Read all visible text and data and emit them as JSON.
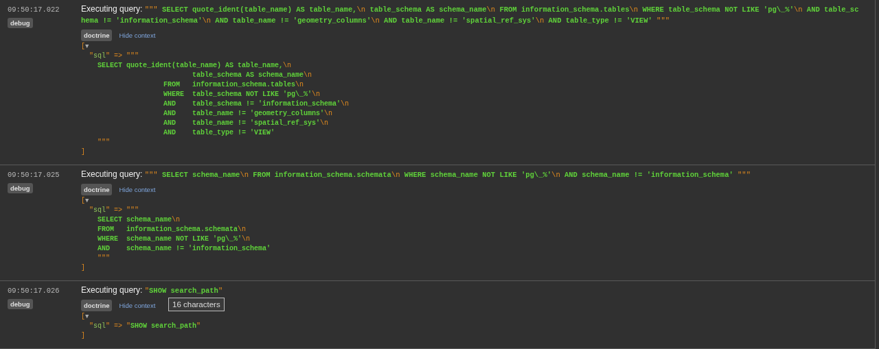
{
  "entries": [
    {
      "time": "09:50:17.022",
      "level": "debug",
      "label": "Executing query:",
      "query": [
        {
          "kind": "punct",
          "text": "\"\"\""
        },
        {
          "kind": "code",
          "text": " SELECT quote_ident(table_name) AS table_name,"
        },
        {
          "kind": "punct",
          "text": "\\n"
        },
        {
          "kind": "code",
          "text": " table_schema AS schema_name"
        },
        {
          "kind": "punct",
          "text": "\\n"
        },
        {
          "kind": "code",
          "text": " FROM information_schema.tables"
        },
        {
          "kind": "punct",
          "text": "\\n"
        },
        {
          "kind": "code",
          "text": " WHERE table_schema NOT LIKE 'pg\\_%'"
        },
        {
          "kind": "punct",
          "text": "\\n"
        },
        {
          "kind": "code",
          "text": " AND table_schema != 'information_schema'"
        },
        {
          "kind": "punct",
          "text": "\\n"
        },
        {
          "kind": "code",
          "text": " AND table_name != 'geometry_columns'"
        },
        {
          "kind": "punct",
          "text": "\\n"
        },
        {
          "kind": "code",
          "text": " AND table_name != 'spatial_ref_sys'"
        },
        {
          "kind": "punct",
          "text": "\\n"
        },
        {
          "kind": "code",
          "text": " AND table_type != 'VIEW' "
        },
        {
          "kind": "punct",
          "text": "\"\"\""
        }
      ],
      "channel": "doctrine",
      "context_link": "Hide context",
      "dump": {
        "open": "[",
        "toggle": "▼",
        "close": "]",
        "lines": [
          [
            {
              "kind": "punct",
              "text": "  \""
            },
            {
              "kind": "key",
              "text": "sql"
            },
            {
              "kind": "punct",
              "text": "\" => \"\"\""
            }
          ],
          [
            {
              "kind": "code",
              "text": "    SELECT quote_ident(table_name) AS table_name,"
            },
            {
              "kind": "punct",
              "text": "\\n"
            }
          ],
          [
            {
              "kind": "code",
              "text": "                           table_schema AS schema_name"
            },
            {
              "kind": "punct",
              "text": "\\n"
            }
          ],
          [
            {
              "kind": "code",
              "text": "                    FROM   information_schema.tables"
            },
            {
              "kind": "punct",
              "text": "\\n"
            }
          ],
          [
            {
              "kind": "code",
              "text": "                    WHERE  table_schema NOT LIKE 'pg\\_%'"
            },
            {
              "kind": "punct",
              "text": "\\n"
            }
          ],
          [
            {
              "kind": "code",
              "text": "                    AND    table_schema != 'information_schema'"
            },
            {
              "kind": "punct",
              "text": "\\n"
            }
          ],
          [
            {
              "kind": "code",
              "text": "                    AND    table_name != 'geometry_columns'"
            },
            {
              "kind": "punct",
              "text": "\\n"
            }
          ],
          [
            {
              "kind": "code",
              "text": "                    AND    table_name != 'spatial_ref_sys'"
            },
            {
              "kind": "punct",
              "text": "\\n"
            }
          ],
          [
            {
              "kind": "code",
              "text": "                    AND    table_type != 'VIEW'"
            }
          ],
          [
            {
              "kind": "punct",
              "text": "    \"\"\""
            }
          ]
        ]
      }
    },
    {
      "time": "09:50:17.025",
      "level": "debug",
      "label": "Executing query:",
      "query": [
        {
          "kind": "punct",
          "text": "\"\"\""
        },
        {
          "kind": "code",
          "text": " SELECT schema_name"
        },
        {
          "kind": "punct",
          "text": "\\n"
        },
        {
          "kind": "code",
          "text": " FROM information_schema.schemata"
        },
        {
          "kind": "punct",
          "text": "\\n"
        },
        {
          "kind": "code",
          "text": " WHERE schema_name NOT LIKE 'pg\\_%'"
        },
        {
          "kind": "punct",
          "text": "\\n"
        },
        {
          "kind": "code",
          "text": " AND schema_name != 'information_schema' "
        },
        {
          "kind": "punct",
          "text": "\"\"\""
        }
      ],
      "channel": "doctrine",
      "context_link": "Hide context",
      "dump": {
        "open": "[",
        "toggle": "▼",
        "close": "]",
        "lines": [
          [
            {
              "kind": "punct",
              "text": "  \""
            },
            {
              "kind": "key",
              "text": "sql"
            },
            {
              "kind": "punct",
              "text": "\" => \"\"\""
            }
          ],
          [
            {
              "kind": "code",
              "text": "    SELECT schema_name"
            },
            {
              "kind": "punct",
              "text": "\\n"
            }
          ],
          [
            {
              "kind": "code",
              "text": "    FROM   information_schema.schemata"
            },
            {
              "kind": "punct",
              "text": "\\n"
            }
          ],
          [
            {
              "kind": "code",
              "text": "    WHERE  schema_name NOT LIKE 'pg\\_%'"
            },
            {
              "kind": "punct",
              "text": "\\n"
            }
          ],
          [
            {
              "kind": "code",
              "text": "    AND    schema_name != 'information_schema'"
            }
          ],
          [
            {
              "kind": "punct",
              "text": "    \"\"\""
            }
          ]
        ]
      }
    },
    {
      "time": "09:50:17.026",
      "level": "debug",
      "label": "Executing query:",
      "query": [
        {
          "kind": "punct",
          "text": "\""
        },
        {
          "kind": "code",
          "text": "SHOW search_path"
        },
        {
          "kind": "punct",
          "text": "\""
        }
      ],
      "channel": "doctrine",
      "context_link": "Hide context",
      "tooltip": "16 characters",
      "dump": {
        "open": "[",
        "toggle": "▼",
        "close": "]",
        "lines": [
          [
            {
              "kind": "punct",
              "text": "  \""
            },
            {
              "kind": "key",
              "text": "sql"
            },
            {
              "kind": "punct",
              "text": "\" => \""
            },
            {
              "kind": "code",
              "text": "SHOW search_path"
            },
            {
              "kind": "punct",
              "text": "\""
            }
          ]
        ]
      }
    }
  ]
}
